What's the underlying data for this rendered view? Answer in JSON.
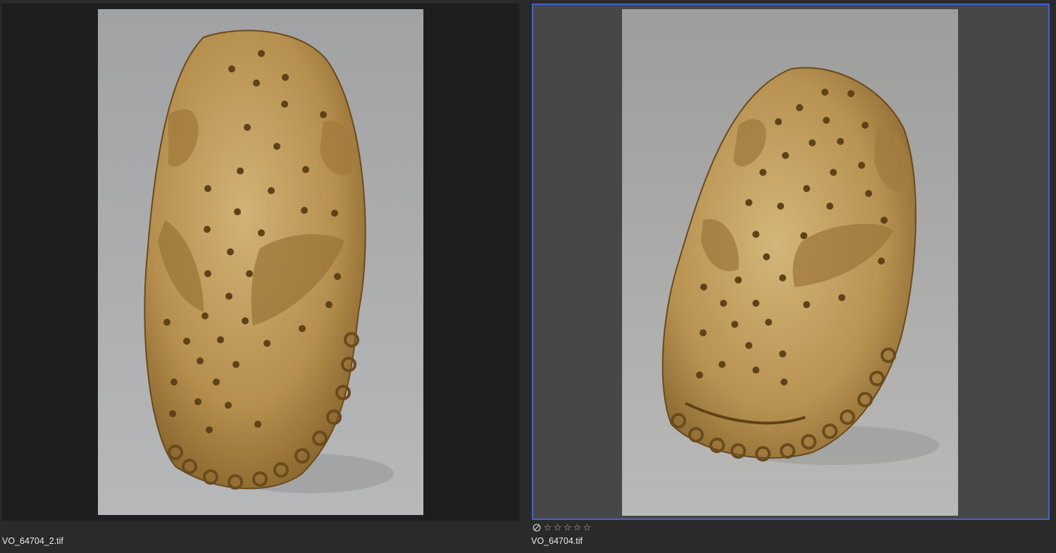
{
  "images": [
    {
      "filename": "VO_64704_2.tif",
      "selected": false,
      "icon": "photo-thumbnail"
    },
    {
      "filename": "VO_64704.tif",
      "selected": true,
      "icon": "photo-thumbnail",
      "rating": {
        "reject_icon": "reject-icon",
        "stars": [
          "☆",
          "☆",
          "☆",
          "☆",
          "☆"
        ]
      }
    }
  ],
  "colors": {
    "selection_border": "#3d63d6",
    "background": "#2a2a2a",
    "frame_dark": "#1e1e1e",
    "frame_selected": "#474747"
  }
}
